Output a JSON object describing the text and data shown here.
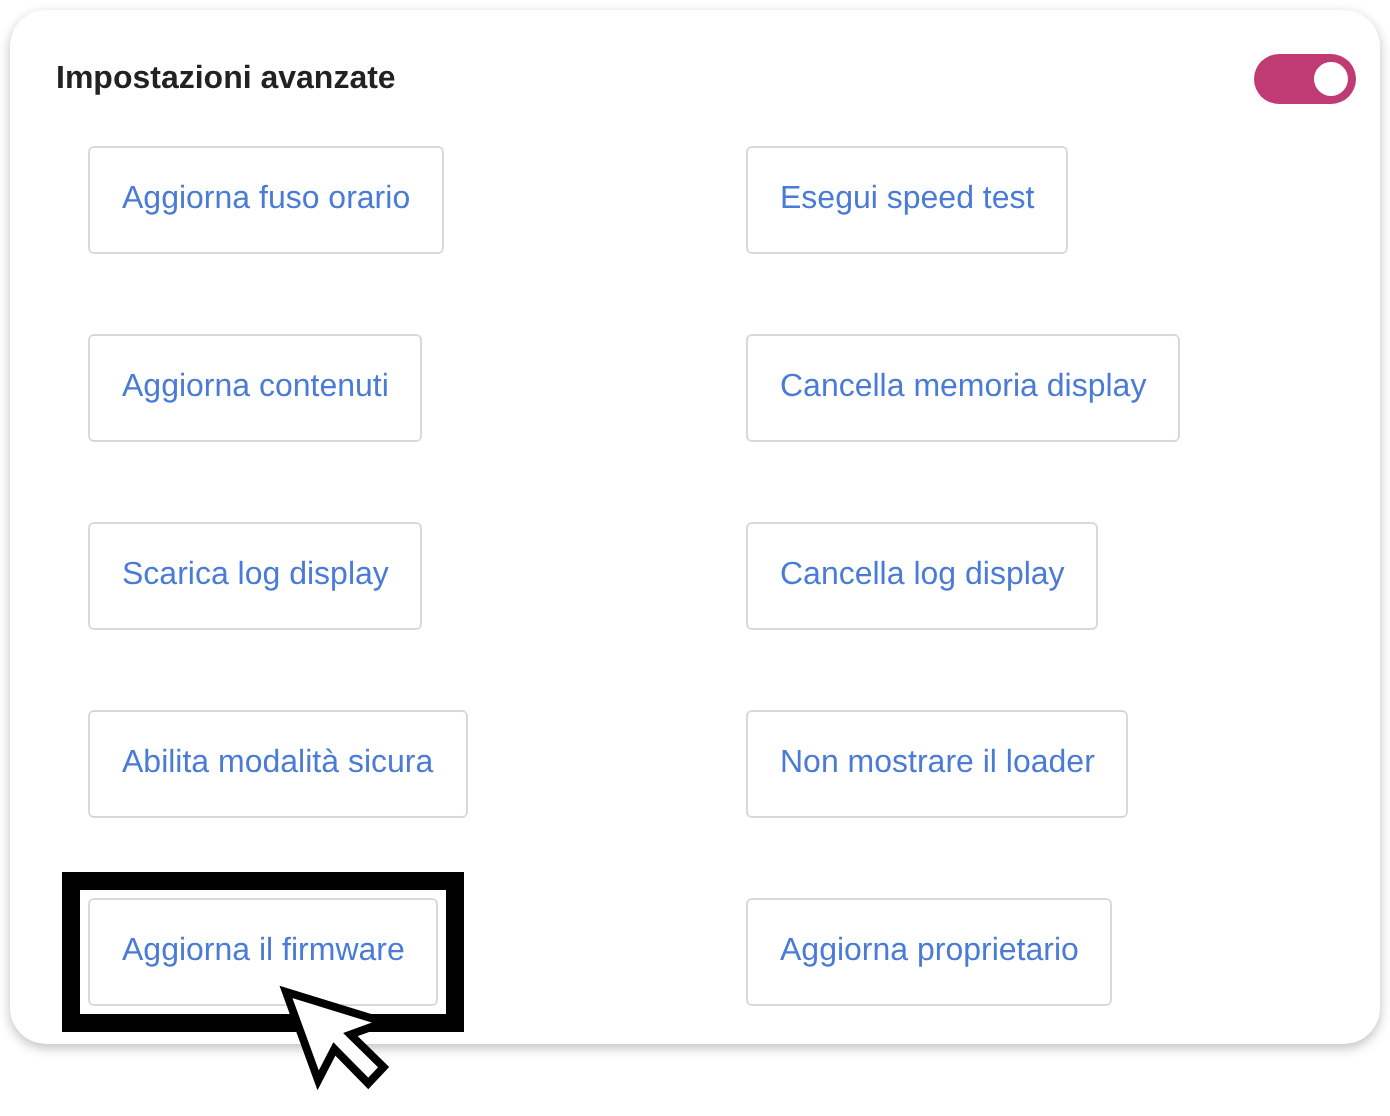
{
  "panel": {
    "title": "Impostazioni avanzate",
    "toggle": {
      "on": true
    }
  },
  "buttons": [
    {
      "label": "Aggiorna fuso orario",
      "highlighted": false
    },
    {
      "label": "Esegui speed test",
      "highlighted": false
    },
    {
      "label": "Aggiorna contenuti",
      "highlighted": false
    },
    {
      "label": "Cancella memoria display",
      "highlighted": false
    },
    {
      "label": "Scarica log display",
      "highlighted": false
    },
    {
      "label": "Cancella log display",
      "highlighted": false
    },
    {
      "label": "Abilita modalità sicura",
      "highlighted": false
    },
    {
      "label": "Non mostrare il loader",
      "highlighted": false
    },
    {
      "label": "Aggiorna il firmware",
      "highlighted": true
    },
    {
      "label": "Aggiorna proprietario",
      "highlighted": false
    }
  ]
}
